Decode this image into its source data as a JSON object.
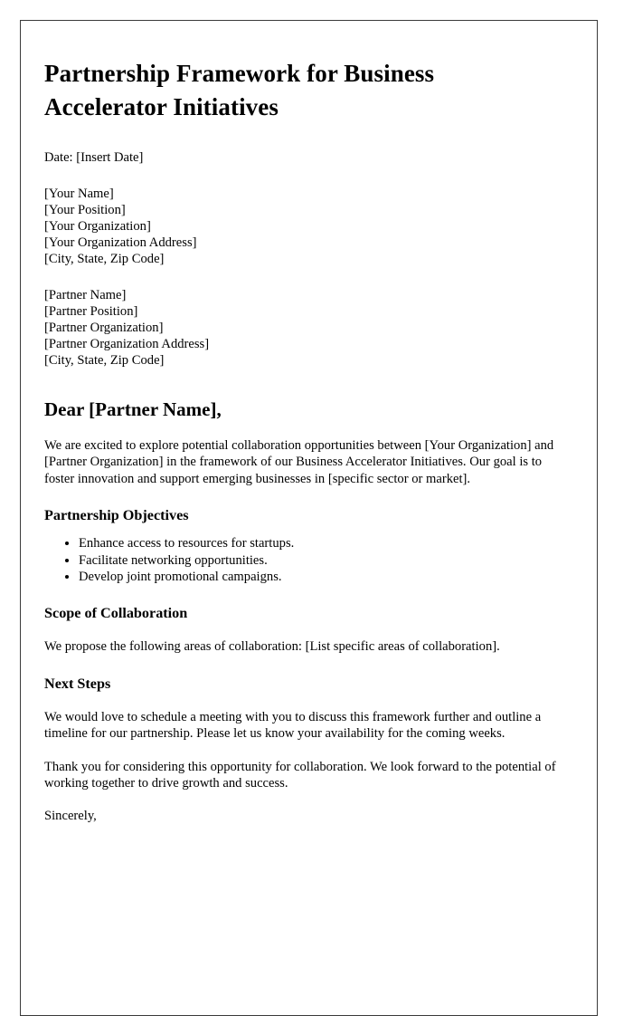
{
  "document": {
    "title": "Partnership Framework for Business Accelerator Initiatives",
    "date_line": "Date: [Insert Date]",
    "sender_block": [
      "[Your Name]",
      "[Your Position]",
      "[Your Organization]",
      "[Your Organization Address]",
      "[City, State, Zip Code]"
    ],
    "recipient_block": [
      "[Partner Name]",
      "[Partner Position]",
      "[Partner Organization]",
      "[Partner Organization Address]",
      "[City, State, Zip Code]"
    ],
    "salutation": "Dear [Partner Name],",
    "intro_paragraph": "We are excited to explore potential collaboration opportunities between [Your Organization] and [Partner Organization] in the framework of our Business Accelerator Initiatives. Our goal is to foster innovation and support emerging businesses in [specific sector or market].",
    "sections": [
      {
        "heading": "Partnership Objectives",
        "bullets": [
          "Enhance access to resources for startups.",
          "Facilitate networking opportunities.",
          "Develop joint promotional campaigns."
        ]
      },
      {
        "heading": "Scope of Collaboration",
        "paragraph": "We propose the following areas of collaboration: [List specific areas of collaboration]."
      },
      {
        "heading": "Next Steps",
        "paragraph": "We would love to schedule a meeting with you to discuss this framework further and outline a timeline for our partnership. Please let us know your availability for the coming weeks."
      }
    ],
    "thanks_paragraph": "Thank you for considering this opportunity for collaboration. We look forward to the potential of working together to drive growth and success.",
    "closing": "Sincerely,"
  }
}
